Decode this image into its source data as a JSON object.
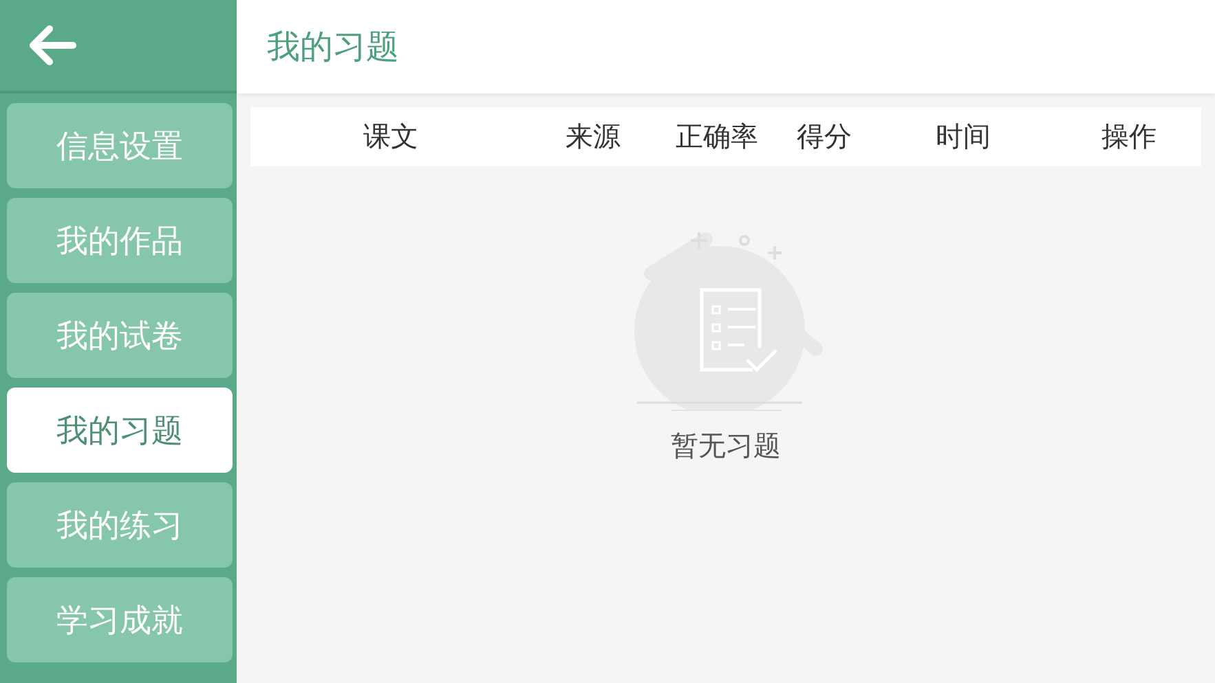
{
  "header": {
    "title": "我的习题"
  },
  "sidebar": {
    "items": [
      {
        "label": "信息设置",
        "selected": false
      },
      {
        "label": "我的作品",
        "selected": false
      },
      {
        "label": "我的试卷",
        "selected": false
      },
      {
        "label": "我的习题",
        "selected": true
      },
      {
        "label": "我的练习",
        "selected": false
      },
      {
        "label": "学习成就",
        "selected": false
      }
    ]
  },
  "table": {
    "columns": [
      "课文",
      "来源",
      "正确率",
      "得分",
      "时间",
      "操作"
    ]
  },
  "empty_state": {
    "message": "暂无习题"
  }
}
